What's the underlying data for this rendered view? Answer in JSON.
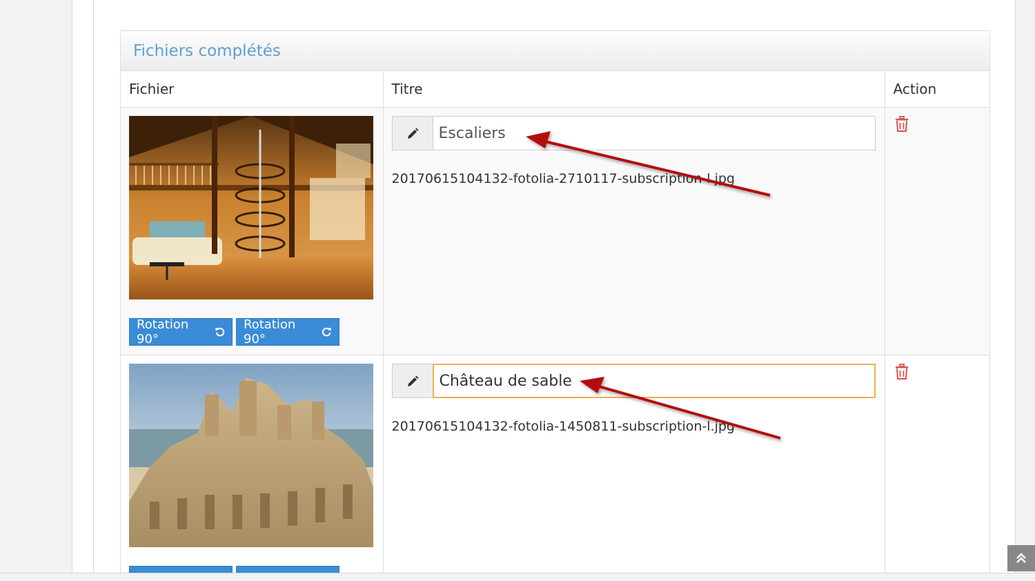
{
  "panel": {
    "title": "Fichiers complétés"
  },
  "table": {
    "columns": [
      "Fichier",
      "Titre",
      "Action"
    ],
    "rows": [
      {
        "image": "photo-escalier-interieur",
        "title_value": "Escaliers",
        "filename": "20170615104132-fotolia-2710117-subscription-l.jpg",
        "rotate_left_label": "Rotation 90°",
        "rotate_right_label": "Rotation 90°",
        "title_focused": false
      },
      {
        "image": "photo-chateau-de-sable",
        "title_value": "Château de sable",
        "filename": "20170615104132-fotolia-1450811-subscription-l.jpg",
        "rotate_left_label": "",
        "rotate_right_label": "",
        "title_focused": true
      }
    ]
  },
  "icons": {
    "edit": "pencil-icon",
    "delete": "trash-icon",
    "rotate_left": "rotate-left-icon",
    "rotate_right": "rotate-right-icon",
    "scroll_top": "double-chevron-up-icon"
  },
  "colors": {
    "title_blue": "#5ea0d2",
    "button_blue": "#3a8cd6",
    "trash_red": "#d9534f",
    "focus_orange": "#f0ad4e",
    "annotation_arrow": "#b41010"
  }
}
